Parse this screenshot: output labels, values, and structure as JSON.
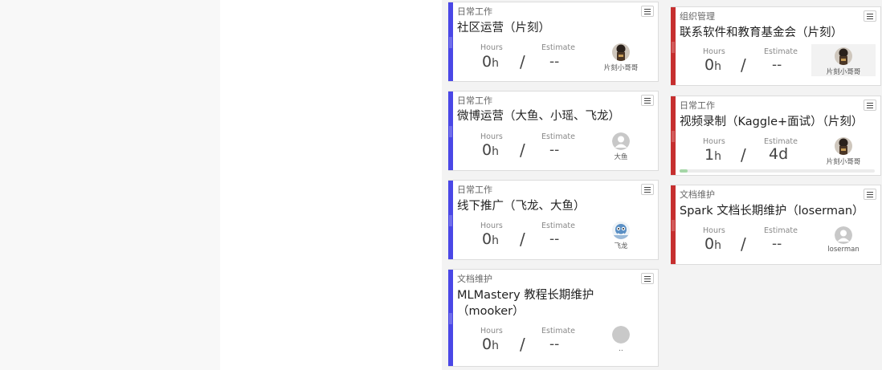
{
  "colors": {
    "blue_bar": "#4a47e6",
    "red_bar": "#c62f2f",
    "progress_fill": "#a5d6a7"
  },
  "labels": {
    "hours": "Hours",
    "estimate": "Estimate",
    "unit_h": "h"
  },
  "cards": [
    {
      "category": "日常工作",
      "title": "社区运营（片刻）",
      "hours": "0",
      "estimate": "--",
      "assignee": "片刻小哥哥",
      "avatar": "photo-avatar-icon"
    },
    {
      "category": "日常工作",
      "title": "微博运营（大鱼、小瑶、飞龙）",
      "hours": "0",
      "estimate": "--",
      "assignee": "大鱼",
      "avatar": "default-user-avatar-icon"
    },
    {
      "category": "日常工作",
      "title": "线下推广（飞龙、大鱼）",
      "hours": "0",
      "estimate": "--",
      "assignee": "飞龙",
      "avatar": "cartoon-avatar-icon"
    },
    {
      "category": "文档维护",
      "title": "MLMastery 教程长期维护（mooker）",
      "hours": "0",
      "estimate": "--",
      "assignee": "..",
      "avatar": "blank-avatar-icon"
    },
    {
      "category": "组织管理",
      "title": "联系软件和教育基金会（片刻）",
      "hours": "0",
      "estimate": "--",
      "assignee": "片刻小哥哥",
      "avatar": "photo-avatar-icon"
    },
    {
      "category": "日常工作",
      "title": "视频录制（Kaggle+面试）（片刻）",
      "hours": "1",
      "estimate": "4d",
      "assignee": "片刻小哥哥",
      "avatar": "photo-avatar-icon",
      "progress": 0.04
    },
    {
      "category": "文档维护",
      "title": "Spark 文档长期维护（loserman）",
      "hours": "0",
      "estimate": "--",
      "assignee": "loserman",
      "avatar": "default-user-avatar-icon"
    }
  ]
}
